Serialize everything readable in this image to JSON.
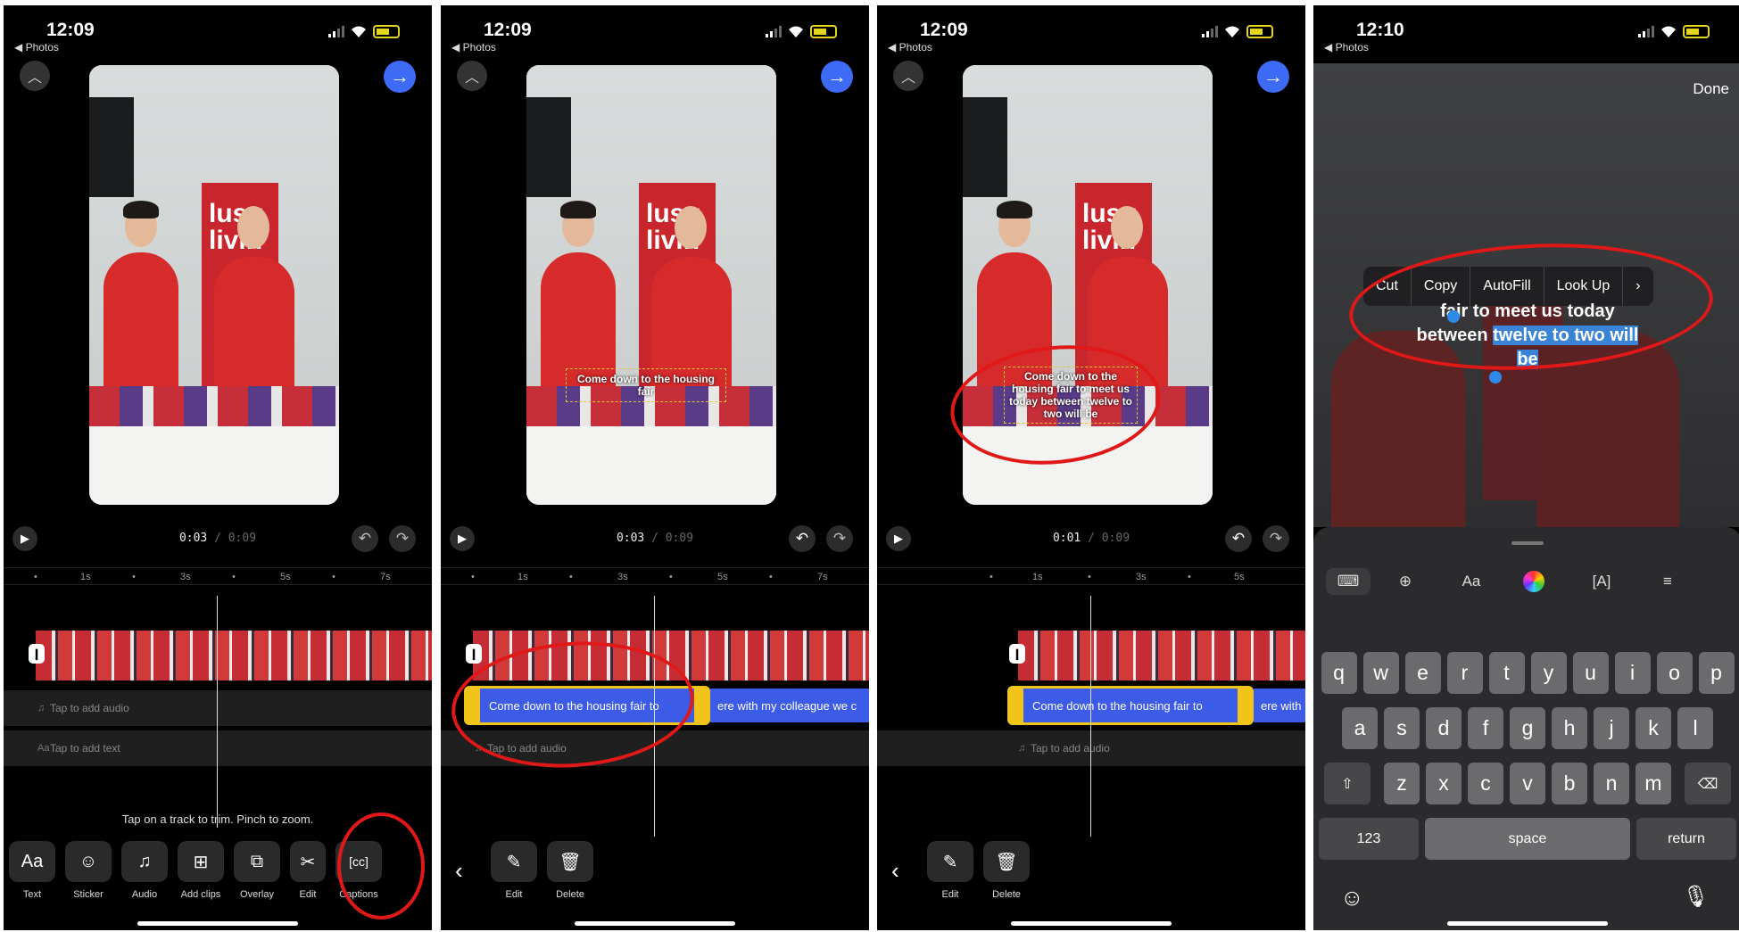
{
  "status": {
    "times": [
      "12:09",
      "12:09",
      "12:09",
      "12:10"
    ],
    "back_label": "◀ Photos"
  },
  "editor": {
    "timecodes": [
      {
        "current": "0:03",
        "total": "0:09"
      },
      {
        "current": "0:03",
        "total": "0:09"
      },
      {
        "current": "0:01",
        "total": "0:09"
      }
    ],
    "ruler": [
      "1s",
      "3s",
      "5s",
      "7s"
    ],
    "audio_track": "Tap to add audio",
    "text_track": "Tap to add text",
    "hint": "Tap on a track to trim. Pinch to zoom.",
    "tools": [
      "Text",
      "Sticker",
      "Audio",
      "Add clips",
      "Overlay",
      "Edit",
      "Captions"
    ],
    "banner_text": "lusu\nlivin",
    "caption_short": "Come down to the housing fair",
    "caption_long": "Come down to the housing fair to meet us today between twelve to two will be",
    "caption_clip": "Come down to the housing fair to",
    "caption_clip_next": "ere with my colleague we c",
    "edit_actions": [
      "Edit",
      "Delete"
    ]
  },
  "text_edit": {
    "done_label": "Done",
    "context_menu": [
      "Cut",
      "Copy",
      "AutoFill",
      "Look Up",
      "›"
    ],
    "line1": "fair to meet us today",
    "line2_pre": "between ",
    "line2_sel": "twelve to two will",
    "line3": "be"
  },
  "keyboard": {
    "row1": [
      "q",
      "w",
      "e",
      "r",
      "t",
      "y",
      "u",
      "i",
      "o",
      "p"
    ],
    "row2": [
      "a",
      "s",
      "d",
      "f",
      "g",
      "h",
      "j",
      "k",
      "l"
    ],
    "row3": [
      "z",
      "x",
      "c",
      "v",
      "b",
      "n",
      "m"
    ],
    "numbers_key": "123",
    "space_key": "space",
    "return_key": "return"
  },
  "colors": {
    "accent": "#3d6bf5",
    "annotation": "#e01818",
    "caption_clip": "#3c5ce8",
    "trim_handle": "#f0c419"
  }
}
